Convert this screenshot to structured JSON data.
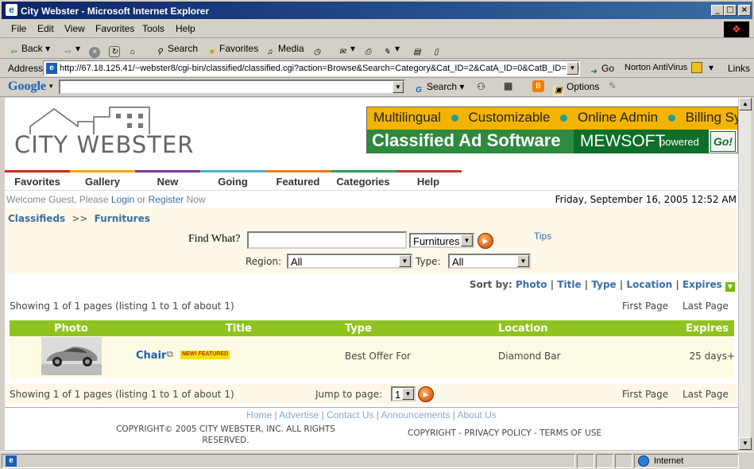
{
  "window": {
    "title": "City Webster - Microsoft Internet Explorer",
    "controls": [
      "_",
      "□",
      "×"
    ]
  },
  "menu": [
    "File",
    "Edit",
    "View",
    "Favorites",
    "Tools",
    "Help"
  ],
  "toolbar": {
    "back": "Back",
    "search": "Search",
    "favorites": "Favorites",
    "media": "Media"
  },
  "address": {
    "label": "Address",
    "url": "http://67.18.125.41/~webster8/cgi-bin/classified/classified.cgi?action=Browse&Search=Category&Cat_ID=2&CatA_ID=0&CatB_ID=0&I",
    "go": "Go",
    "norton": "Norton AntiVirus",
    "links": "Links"
  },
  "googlebar": {
    "logo": "Google",
    "search": "Search",
    "options": "Options"
  },
  "site": {
    "logo": "CITY WEBSTER",
    "banner": {
      "features": [
        "Multilingual",
        "Customizable",
        "Online Admin",
        "Billing System"
      ],
      "product": "Classified Ad Software",
      "brand": "MEWSOFT",
      "powered": "powered",
      "go": "Go!"
    },
    "nav": [
      "Favorites",
      "Gallery",
      "New",
      "Going",
      "Featured",
      "Categories",
      "Help"
    ],
    "nav_colors": [
      "#d9261c",
      "#f2a900",
      "#7d3c98",
      "#4bb3c8",
      "#e67e22",
      "#2e9e5b",
      "#c0392b"
    ],
    "welcome": {
      "prefix": "Welcome Guest, Please",
      "login": "Login",
      "or": "or",
      "register": "Register",
      "suffix": "Now"
    },
    "datetime": "Friday, September 16, 2005 12:52 AM",
    "breadcrumb": {
      "root": "Classifieds",
      "sep": ">>",
      "current": "Furnitures"
    },
    "search": {
      "find_label": "Find What?",
      "find_value": "",
      "category": "Furnitures",
      "tips": "Tips",
      "region_label": "Region:",
      "region_value": "All",
      "type_label": "Type:",
      "type_value": "All"
    },
    "sort": {
      "label": "Sort by:",
      "options": [
        "Photo",
        "Title",
        "Type",
        "Location",
        "Expires"
      ]
    },
    "paging": {
      "showing": "Showing 1 of 1 pages (listing 1 to 1 of about 1)",
      "first": "First Page",
      "last": "Last Page",
      "jump": "Jump to page:",
      "page": "1"
    },
    "table": {
      "headers": [
        "Photo",
        "Title",
        "Type",
        "Location",
        "Expires"
      ],
      "rows": [
        {
          "title": "Chair",
          "badge": "NEW! FEATURED",
          "type": "Best Offer For",
          "location": "Diamond Bar",
          "expires": "25 days+"
        }
      ]
    },
    "footer": {
      "links": [
        "Home",
        "Advertise",
        "Contact Us",
        "Announcements",
        "About Us"
      ],
      "copyright": "COPYRIGHT© 2005 CITY WEBSTER, INC. ALL RIGHTS RESERVED.",
      "legal": "COPYRIGHT - PRIVACY POLICY - TERMS OF USE"
    }
  },
  "status": {
    "zone": "Internet"
  }
}
